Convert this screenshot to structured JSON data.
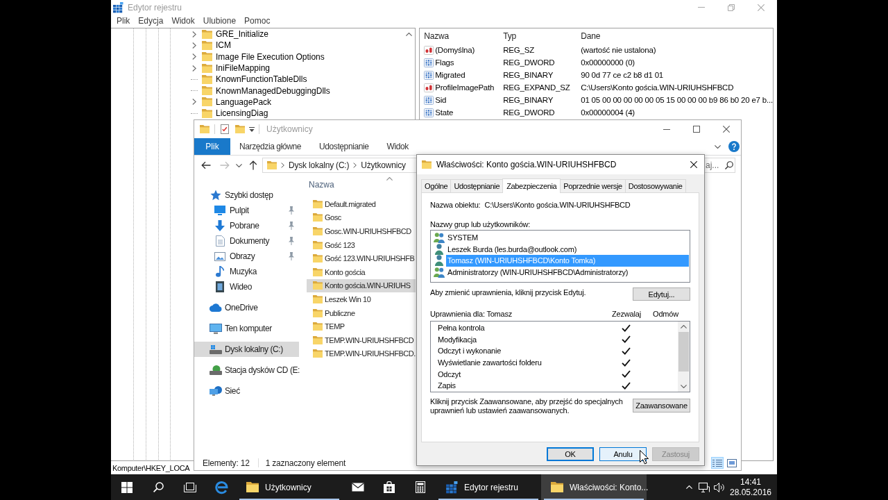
{
  "registry_editor": {
    "title": "Edytor rejestru",
    "active": false,
    "menu": [
      "Plik",
      "Edycja",
      "Widok",
      "Ulubione",
      "Pomoc"
    ],
    "tree": [
      {
        "label": "GRE_Initialize",
        "expandable": true
      },
      {
        "label": "ICM",
        "expandable": true
      },
      {
        "label": "Image File Execution Options",
        "expandable": true
      },
      {
        "label": "IniFileMapping",
        "expandable": true
      },
      {
        "label": "KnownFunctionTableDlls",
        "expandable": false
      },
      {
        "label": "KnownManagedDebuggingDlls",
        "expandable": false
      },
      {
        "label": "LanguagePack",
        "expandable": true
      },
      {
        "label": "LicensingDiag",
        "expandable": false
      }
    ],
    "values": {
      "columns": [
        "Nazwa",
        "Typ",
        "Dane"
      ],
      "rows": [
        {
          "kind": "string",
          "name": "(Domyślna)",
          "type": "REG_SZ",
          "data": "(wartość nie ustalona)"
        },
        {
          "kind": "binary",
          "name": "Flags",
          "type": "REG_DWORD",
          "data": "0x00000000 (0)"
        },
        {
          "kind": "binary",
          "name": "Migrated",
          "type": "REG_BINARY",
          "data": "90 0d 77 ce c2 b8 d1 01"
        },
        {
          "kind": "string",
          "name": "ProfileImagePath",
          "type": "REG_EXPAND_SZ",
          "data": "C:\\Users\\Konto gościa.WIN-URIUHSHFBCD"
        },
        {
          "kind": "binary",
          "name": "Sid",
          "type": "REG_BINARY",
          "data": "01 05 00 00 00 00 00 05 15 00 00 00 b9 86 b0 20 e7 b..."
        },
        {
          "kind": "binary",
          "name": "State",
          "type": "REG_DWORD",
          "data": "0x00000004 (4)"
        }
      ]
    },
    "status_bar": "Komputer\\HKEY_LOCA"
  },
  "explorer": {
    "title": "Użytkownicy",
    "active": false,
    "file_tab": "Plik",
    "ribbon_tabs": [
      "Narzędzia główne",
      "Udostępnianie",
      "Widok"
    ],
    "address": [
      "Dysk lokalny (C:)",
      "Użytkownicy"
    ],
    "search": {
      "placeholder": "aj..."
    },
    "navigation": [
      {
        "label": "Szybki dostęp",
        "kind": "star",
        "selected": false,
        "children": [
          {
            "label": "Pulpit",
            "kind": "desktop",
            "pinned": true,
            "selected": false
          },
          {
            "label": "Pobrane",
            "kind": "download",
            "pinned": true,
            "selected": false
          },
          {
            "label": "Dokumenty",
            "kind": "documents",
            "pinned": true,
            "selected": false
          },
          {
            "label": "Obrazy",
            "kind": "pictures",
            "pinned": true,
            "selected": false
          },
          {
            "label": "Muzyka",
            "kind": "music",
            "pinned": false,
            "selected": false
          },
          {
            "label": "Wideo",
            "kind": "video",
            "pinned": false,
            "selected": false
          }
        ]
      },
      {
        "label": "OneDrive",
        "kind": "cloud",
        "selected": false
      },
      {
        "label": "Ten komputer",
        "kind": "computer",
        "selected": false
      },
      {
        "label": "Dysk lokalny (C:)",
        "kind": "drive",
        "selected": true
      },
      {
        "label": "Stacja dysków CD (E:",
        "kind": "cd",
        "selected": false
      },
      {
        "label": "Sieć",
        "kind": "network",
        "selected": false
      }
    ],
    "column_header": "Nazwa",
    "files": [
      {
        "name": "Default.migrated",
        "selected": false
      },
      {
        "name": "Gosc",
        "selected": false
      },
      {
        "name": "Gosc.WIN-URIUHSHFBCD",
        "selected": false
      },
      {
        "name": "Gość 123",
        "selected": false
      },
      {
        "name": "Gość 123.WIN-URIUHSHFB",
        "selected": false
      },
      {
        "name": "Konto gościa",
        "selected": false
      },
      {
        "name": "Konto gościa.WIN-URIUHS",
        "selected": true
      },
      {
        "name": "Leszek Win 10",
        "selected": false
      },
      {
        "name": "Publiczne",
        "selected": false
      },
      {
        "name": "TEMP",
        "selected": false
      },
      {
        "name": "TEMP.WIN-URIUHSHFBCD",
        "selected": false
      },
      {
        "name": "TEMP.WIN-URIUHSHFBCD.",
        "selected": false
      }
    ],
    "status": {
      "count": "Elementy: 12",
      "selection": "1 zaznaczony element"
    },
    "view_modes": [
      {
        "kind": "details",
        "selected": true
      },
      {
        "kind": "tiles",
        "selected": false
      }
    ]
  },
  "properties_dialog": {
    "title": "Właściwości: Konto gościa.WIN-URIUHSHFBCD",
    "active": true,
    "tabs": [
      {
        "label": "Ogólne",
        "selected": false
      },
      {
        "label": "Udostępnianie",
        "selected": false
      },
      {
        "label": "Zabezpieczenia",
        "selected": true
      },
      {
        "label": "Poprzednie wersje",
        "selected": false
      },
      {
        "label": "Dostosowywanie",
        "selected": false
      }
    ],
    "object_name_label": "Nazwa obiektu:",
    "object_name": "C:\\Users\\Konto gościa.WIN-URIUHSHFBCD",
    "users_label": "Nazwy grup lub użytkowników:",
    "users": [
      {
        "label": "SYSTEM",
        "kind": "group",
        "selected": false
      },
      {
        "label": "Leszek Burda (les.burda@outlook.com)",
        "kind": "user",
        "selected": false
      },
      {
        "label": "Tomasz (WIN-URIUHSHFBCD\\Konto Tomka)",
        "kind": "user",
        "selected": true
      },
      {
        "label": "Administratorzy (WIN-URIUHSHFBCD\\Administratorzy)",
        "kind": "group",
        "selected": false
      }
    ],
    "edit_hint": "Aby zmienić uprawnienia, kliknij przycisk Edytuj.",
    "edit_button": "Edytuj...",
    "permissions_label": "Uprawnienia dla: Tomasz",
    "permission_columns": [
      "Zezwalaj",
      "Odmów"
    ],
    "permissions": [
      {
        "name": "Pełna kontrola",
        "allow": true
      },
      {
        "name": "Modyfikacja",
        "allow": true
      },
      {
        "name": "Odczyt i wykonanie",
        "allow": true
      },
      {
        "name": "Wyświetlanie zawartości folderu",
        "allow": true
      },
      {
        "name": "Odczyt",
        "allow": true
      },
      {
        "name": "Zapis",
        "allow": true
      }
    ],
    "advanced_hint": "Kliknij przycisk Zaawansowane, aby przejść do specjalnych uprawnień lub ustawień zaawansowanych.",
    "advanced_button": "Zaawansowane",
    "buttons": [
      {
        "label": "OK",
        "default": true,
        "hovered": false,
        "disabled": false
      },
      {
        "label": "Anulu",
        "default": false,
        "hovered": true,
        "disabled": false
      },
      {
        "label": "Zastosuj",
        "default": false,
        "hovered": false,
        "disabled": true
      }
    ]
  },
  "taskbar": {
    "apps": [
      {
        "kind": "browser",
        "open": false,
        "selected": false
      },
      {
        "kind": "folder",
        "label": "Użytkownicy",
        "open": true,
        "selected": false
      },
      {
        "kind": "mail",
        "open": false,
        "selected": false
      },
      {
        "kind": "store",
        "open": false,
        "selected": false
      },
      {
        "kind": "calculator",
        "open": false,
        "selected": false
      },
      {
        "kind": "regedit",
        "label": "Edytor rejestru",
        "open": true,
        "selected": false
      },
      {
        "kind": "folder",
        "label": "Właściwości: Konto...",
        "open": true,
        "selected": true
      }
    ],
    "clock": {
      "time": "14:41",
      "date": "28.05.2016"
    }
  }
}
